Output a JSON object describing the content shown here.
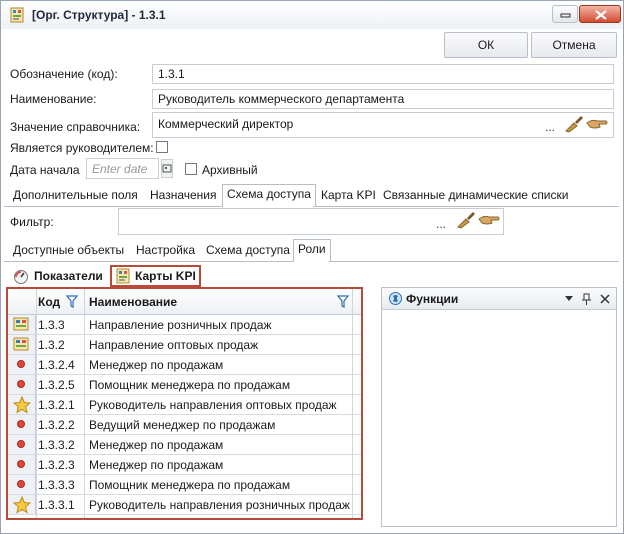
{
  "window": {
    "title": "[Орг. Структура] - 1.3.1",
    "accent": "#b94a3a"
  },
  "actions": {
    "ok": "ОК",
    "cancel": "Отмена"
  },
  "form": {
    "code_label": "Обозначение (код):",
    "code_value": "1.3.1",
    "name_label": "Наименование:",
    "name_value": "Руководитель коммерческого департамента",
    "ref_label": "Значение справочника:",
    "ref_value": "Коммерческий директор",
    "ref_ellipsis": "...",
    "is_head_label": "Является руководителем:",
    "start_date_label": "Дата начала",
    "start_date_placeholder": "Enter date",
    "archive_label": "Архивный"
  },
  "tabs": [
    "Дополнительные поля",
    "Назначения",
    "Схема доступа",
    "Карта KPI",
    "Связанные динамические списки"
  ],
  "filter": {
    "label": "Фильтр:",
    "ellipsis": "..."
  },
  "subtabs": [
    "Доступные объекты",
    "Настройка",
    "Схема доступа",
    "Роли"
  ],
  "toolbar": {
    "indicators": "Показатели",
    "kpi_cards": "Карты KPI"
  },
  "grid": {
    "col_code": "Код",
    "col_name": "Наименование",
    "rows": [
      {
        "icon": "kpi-card-icon",
        "code": "1.3.3",
        "name": "Направление розничных продаж"
      },
      {
        "icon": "kpi-card-icon",
        "code": "1.3.2",
        "name": "Направление оптовых продаж"
      },
      {
        "icon": "red-dot-icon",
        "code": "1.3.2.4",
        "name": "Менеджер по продажам"
      },
      {
        "icon": "red-dot-icon",
        "code": "1.3.2.5",
        "name": "Помощник менеджера по продажам"
      },
      {
        "icon": "star-icon",
        "code": "1.3.2.1",
        "name": "Руководитель направления оптовых продаж"
      },
      {
        "icon": "red-dot-icon",
        "code": "1.3.2.2",
        "name": "Ведущий менеджер по продажам"
      },
      {
        "icon": "red-dot-icon",
        "code": "1.3.3.2",
        "name": "Менеджер по продажам"
      },
      {
        "icon": "red-dot-icon",
        "code": "1.3.2.3",
        "name": "Менеджер по продажам"
      },
      {
        "icon": "red-dot-icon",
        "code": "1.3.3.3",
        "name": "Помощник менеджера по продажам"
      },
      {
        "icon": "star-icon",
        "code": "1.3.3.1",
        "name": "Руководитель направления розничных продаж"
      }
    ]
  },
  "functions_panel": {
    "title": "Функции"
  }
}
